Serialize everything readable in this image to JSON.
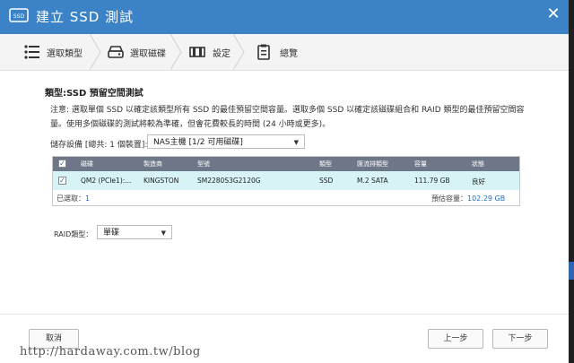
{
  "window": {
    "title": "建立 SSD 測試",
    "title_icon": "ssd-icon",
    "close_icon": "close-icon"
  },
  "steps": [
    {
      "label": "選取類型",
      "icon": "list-icon"
    },
    {
      "label": "選取磁碟",
      "icon": "disk-icon"
    },
    {
      "label": "設定",
      "icon": "settings-icon"
    },
    {
      "label": "總覽",
      "icon": "clipboard-icon"
    }
  ],
  "section": {
    "title": "類型:SSD 預留空間測試",
    "description": "注意: 選取單個 SSD 以確定該類型所有 SSD 的最佳預留空間容量。選取多個 SSD 以確定該磁碟組合和 RAID 類型的最佳預留空間容量。使用多個磁碟的測試將較為準確，但會花費較長的時間 (24 小時或更多)。"
  },
  "storage": {
    "label": "儲存設備 [總共: 1 個裝置]:",
    "selected": "NAS主機 [1/2 可用磁碟]"
  },
  "table": {
    "headers": [
      "磁碟",
      "製造商",
      "型號",
      "類型",
      "匯流排類型",
      "容量",
      "狀態"
    ],
    "rows": [
      {
        "disk": "QM2 (PCIe1):...",
        "vendor": "KINGSTON",
        "model": "SM2280S3G2120G",
        "type": "SSD",
        "bus": "M.2 SATA",
        "capacity": "111.79 GB",
        "status": "良好",
        "checked": true
      }
    ],
    "selected_label": "已選取：",
    "selected_count": "1",
    "estimated_label": "預估容量：",
    "estimated_value": "102.29 GB"
  },
  "raid": {
    "label": "RAID類型：",
    "selected": "單碟"
  },
  "buttons": {
    "cancel": "取消",
    "prev": "上一步",
    "next": "下一步"
  },
  "watermark": "http://hardaway.com.tw/blog",
  "colors": {
    "titlebar": "#3b83c6",
    "header": "#6d7788",
    "row_selected": "#d7f3f5",
    "accent_text": "#1d6fc0"
  }
}
